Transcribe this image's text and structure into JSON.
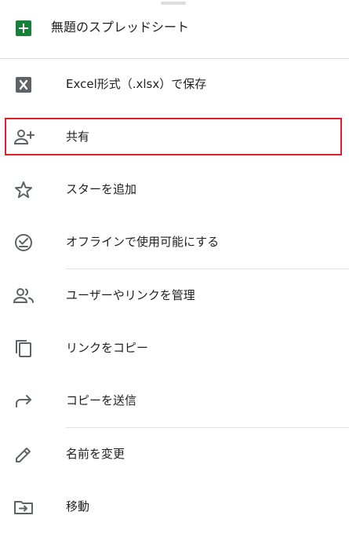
{
  "header": {
    "title": "無題のスプレッドシート",
    "icon": "google-sheets-icon"
  },
  "menu": {
    "items": [
      {
        "label": "Excel形式（.xlsx）で保存",
        "icon": "excel-icon"
      },
      {
        "label": "共有",
        "icon": "add-person-icon"
      },
      {
        "label": "スターを追加",
        "icon": "star-outline-icon"
      },
      {
        "label": "オフラインで使用可能にする",
        "icon": "offline-check-icon"
      },
      {
        "label": "ユーザーやリンクを管理",
        "icon": "people-icon"
      },
      {
        "label": "リンクをコピー",
        "icon": "copy-icon"
      },
      {
        "label": "コピーを送信",
        "icon": "send-arrow-icon"
      },
      {
        "label": "名前を変更",
        "icon": "pencil-icon"
      },
      {
        "label": "移動",
        "icon": "move-folder-icon"
      }
    ]
  },
  "highlight": {
    "target": "共有",
    "color": "#e0202a"
  },
  "colors": {
    "sheets_green": "#188038",
    "icon_gray": "#5f6368",
    "text": "#202124"
  }
}
